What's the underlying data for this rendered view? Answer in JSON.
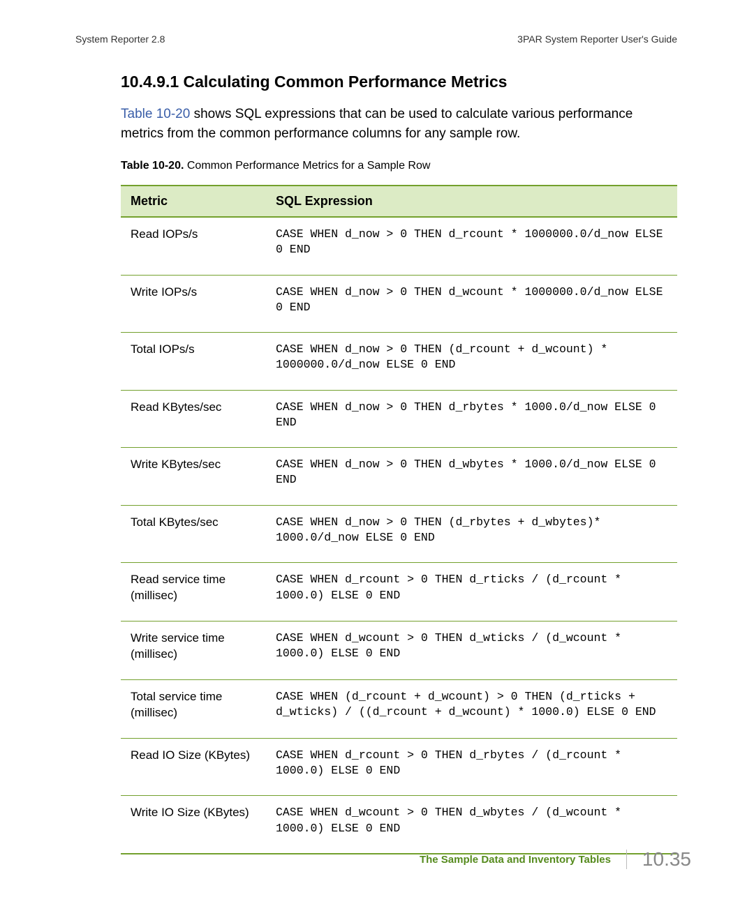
{
  "header": {
    "left": "System Reporter 2.8",
    "right": "3PAR System Reporter User's Guide"
  },
  "section": {
    "number": "10.4.9.1",
    "title": "Calculating Common Performance Metrics"
  },
  "intro": {
    "link_text": "Table 10-20",
    "rest": " shows SQL expressions that can be used to calculate various performance metrics from the common performance columns for any sample row."
  },
  "table_caption": {
    "label": "Table 10-20.",
    "text": "  Common Performance Metrics for a Sample Row"
  },
  "table": {
    "headers": [
      "Metric",
      "SQL Expression"
    ],
    "rows": [
      {
        "metric": "Read IOPs/s",
        "sql": "CASE WHEN d_now > 0 THEN d_rcount * 1000000.0/d_now ELSE 0 END"
      },
      {
        "metric": "Write IOPs/s",
        "sql": "CASE WHEN d_now > 0 THEN d_wcount * 1000000.0/d_now ELSE 0 END"
      },
      {
        "metric": "Total IOPs/s",
        "sql": "CASE WHEN d_now > 0 THEN (d_rcount + d_wcount) * 1000000.0/d_now ELSE 0 END"
      },
      {
        "metric": "Read KBytes/sec",
        "sql": "CASE WHEN d_now > 0 THEN d_rbytes * 1000.0/d_now ELSE 0 END"
      },
      {
        "metric": "Write KBytes/sec",
        "sql": "CASE WHEN d_now > 0 THEN d_wbytes * 1000.0/d_now ELSE 0 END"
      },
      {
        "metric": "Total KBytes/sec",
        "sql": "CASE WHEN d_now > 0 THEN (d_rbytes + d_wbytes)* 1000.0/d_now ELSE 0 END"
      },
      {
        "metric": "Read service time (millisec)",
        "sql": "CASE WHEN d_rcount > 0 THEN d_rticks / (d_rcount * 1000.0) ELSE 0 END"
      },
      {
        "metric": "Write service time (millisec)",
        "sql": "CASE WHEN d_wcount > 0 THEN d_wticks / (d_wcount * 1000.0) ELSE 0 END"
      },
      {
        "metric": "Total service time (millisec)",
        "sql": "CASE WHEN (d_rcount + d_wcount) > 0 THEN (d_rticks + d_wticks) / ((d_rcount + d_wcount) * 1000.0) ELSE 0 END"
      },
      {
        "metric": "Read IO Size (KBytes)",
        "sql": "CASE WHEN d_rcount > 0 THEN d_rbytes / (d_rcount * 1000.0) ELSE 0 END"
      },
      {
        "metric": "Write IO Size (KBytes)",
        "sql": "CASE WHEN d_wcount > 0 THEN d_wbytes / (d_wcount * 1000.0) ELSE 0 END"
      }
    ]
  },
  "footer": {
    "title": "The Sample Data and Inventory Tables",
    "page": "10.35"
  }
}
